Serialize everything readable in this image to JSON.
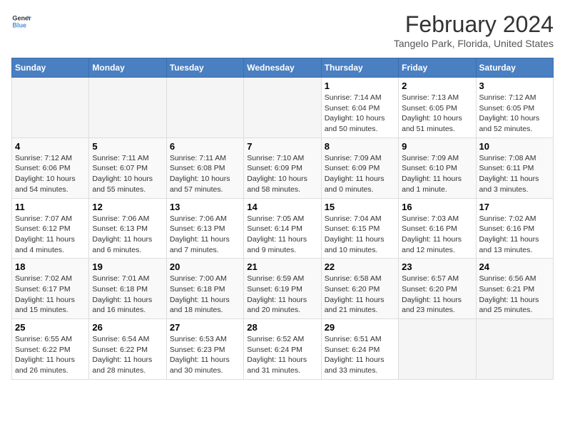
{
  "logo": {
    "line1": "General",
    "line2": "Blue"
  },
  "title": "February 2024",
  "subtitle": "Tangelo Park, Florida, United States",
  "days_of_week": [
    "Sunday",
    "Monday",
    "Tuesday",
    "Wednesday",
    "Thursday",
    "Friday",
    "Saturday"
  ],
  "weeks": [
    [
      {
        "day": "",
        "info": ""
      },
      {
        "day": "",
        "info": ""
      },
      {
        "day": "",
        "info": ""
      },
      {
        "day": "",
        "info": ""
      },
      {
        "day": "1",
        "info": "Sunrise: 7:14 AM\nSunset: 6:04 PM\nDaylight: 10 hours\nand 50 minutes."
      },
      {
        "day": "2",
        "info": "Sunrise: 7:13 AM\nSunset: 6:05 PM\nDaylight: 10 hours\nand 51 minutes."
      },
      {
        "day": "3",
        "info": "Sunrise: 7:12 AM\nSunset: 6:05 PM\nDaylight: 10 hours\nand 52 minutes."
      }
    ],
    [
      {
        "day": "4",
        "info": "Sunrise: 7:12 AM\nSunset: 6:06 PM\nDaylight: 10 hours\nand 54 minutes."
      },
      {
        "day": "5",
        "info": "Sunrise: 7:11 AM\nSunset: 6:07 PM\nDaylight: 10 hours\nand 55 minutes."
      },
      {
        "day": "6",
        "info": "Sunrise: 7:11 AM\nSunset: 6:08 PM\nDaylight: 10 hours\nand 57 minutes."
      },
      {
        "day": "7",
        "info": "Sunrise: 7:10 AM\nSunset: 6:09 PM\nDaylight: 10 hours\nand 58 minutes."
      },
      {
        "day": "8",
        "info": "Sunrise: 7:09 AM\nSunset: 6:09 PM\nDaylight: 11 hours\nand 0 minutes."
      },
      {
        "day": "9",
        "info": "Sunrise: 7:09 AM\nSunset: 6:10 PM\nDaylight: 11 hours\nand 1 minute."
      },
      {
        "day": "10",
        "info": "Sunrise: 7:08 AM\nSunset: 6:11 PM\nDaylight: 11 hours\nand 3 minutes."
      }
    ],
    [
      {
        "day": "11",
        "info": "Sunrise: 7:07 AM\nSunset: 6:12 PM\nDaylight: 11 hours\nand 4 minutes."
      },
      {
        "day": "12",
        "info": "Sunrise: 7:06 AM\nSunset: 6:13 PM\nDaylight: 11 hours\nand 6 minutes."
      },
      {
        "day": "13",
        "info": "Sunrise: 7:06 AM\nSunset: 6:13 PM\nDaylight: 11 hours\nand 7 minutes."
      },
      {
        "day": "14",
        "info": "Sunrise: 7:05 AM\nSunset: 6:14 PM\nDaylight: 11 hours\nand 9 minutes."
      },
      {
        "day": "15",
        "info": "Sunrise: 7:04 AM\nSunset: 6:15 PM\nDaylight: 11 hours\nand 10 minutes."
      },
      {
        "day": "16",
        "info": "Sunrise: 7:03 AM\nSunset: 6:16 PM\nDaylight: 11 hours\nand 12 minutes."
      },
      {
        "day": "17",
        "info": "Sunrise: 7:02 AM\nSunset: 6:16 PM\nDaylight: 11 hours\nand 13 minutes."
      }
    ],
    [
      {
        "day": "18",
        "info": "Sunrise: 7:02 AM\nSunset: 6:17 PM\nDaylight: 11 hours\nand 15 minutes."
      },
      {
        "day": "19",
        "info": "Sunrise: 7:01 AM\nSunset: 6:18 PM\nDaylight: 11 hours\nand 16 minutes."
      },
      {
        "day": "20",
        "info": "Sunrise: 7:00 AM\nSunset: 6:18 PM\nDaylight: 11 hours\nand 18 minutes."
      },
      {
        "day": "21",
        "info": "Sunrise: 6:59 AM\nSunset: 6:19 PM\nDaylight: 11 hours\nand 20 minutes."
      },
      {
        "day": "22",
        "info": "Sunrise: 6:58 AM\nSunset: 6:20 PM\nDaylight: 11 hours\nand 21 minutes."
      },
      {
        "day": "23",
        "info": "Sunrise: 6:57 AM\nSunset: 6:20 PM\nDaylight: 11 hours\nand 23 minutes."
      },
      {
        "day": "24",
        "info": "Sunrise: 6:56 AM\nSunset: 6:21 PM\nDaylight: 11 hours\nand 25 minutes."
      }
    ],
    [
      {
        "day": "25",
        "info": "Sunrise: 6:55 AM\nSunset: 6:22 PM\nDaylight: 11 hours\nand 26 minutes."
      },
      {
        "day": "26",
        "info": "Sunrise: 6:54 AM\nSunset: 6:22 PM\nDaylight: 11 hours\nand 28 minutes."
      },
      {
        "day": "27",
        "info": "Sunrise: 6:53 AM\nSunset: 6:23 PM\nDaylight: 11 hours\nand 30 minutes."
      },
      {
        "day": "28",
        "info": "Sunrise: 6:52 AM\nSunset: 6:24 PM\nDaylight: 11 hours\nand 31 minutes."
      },
      {
        "day": "29",
        "info": "Sunrise: 6:51 AM\nSunset: 6:24 PM\nDaylight: 11 hours\nand 33 minutes."
      },
      {
        "day": "",
        "info": ""
      },
      {
        "day": "",
        "info": ""
      }
    ]
  ]
}
